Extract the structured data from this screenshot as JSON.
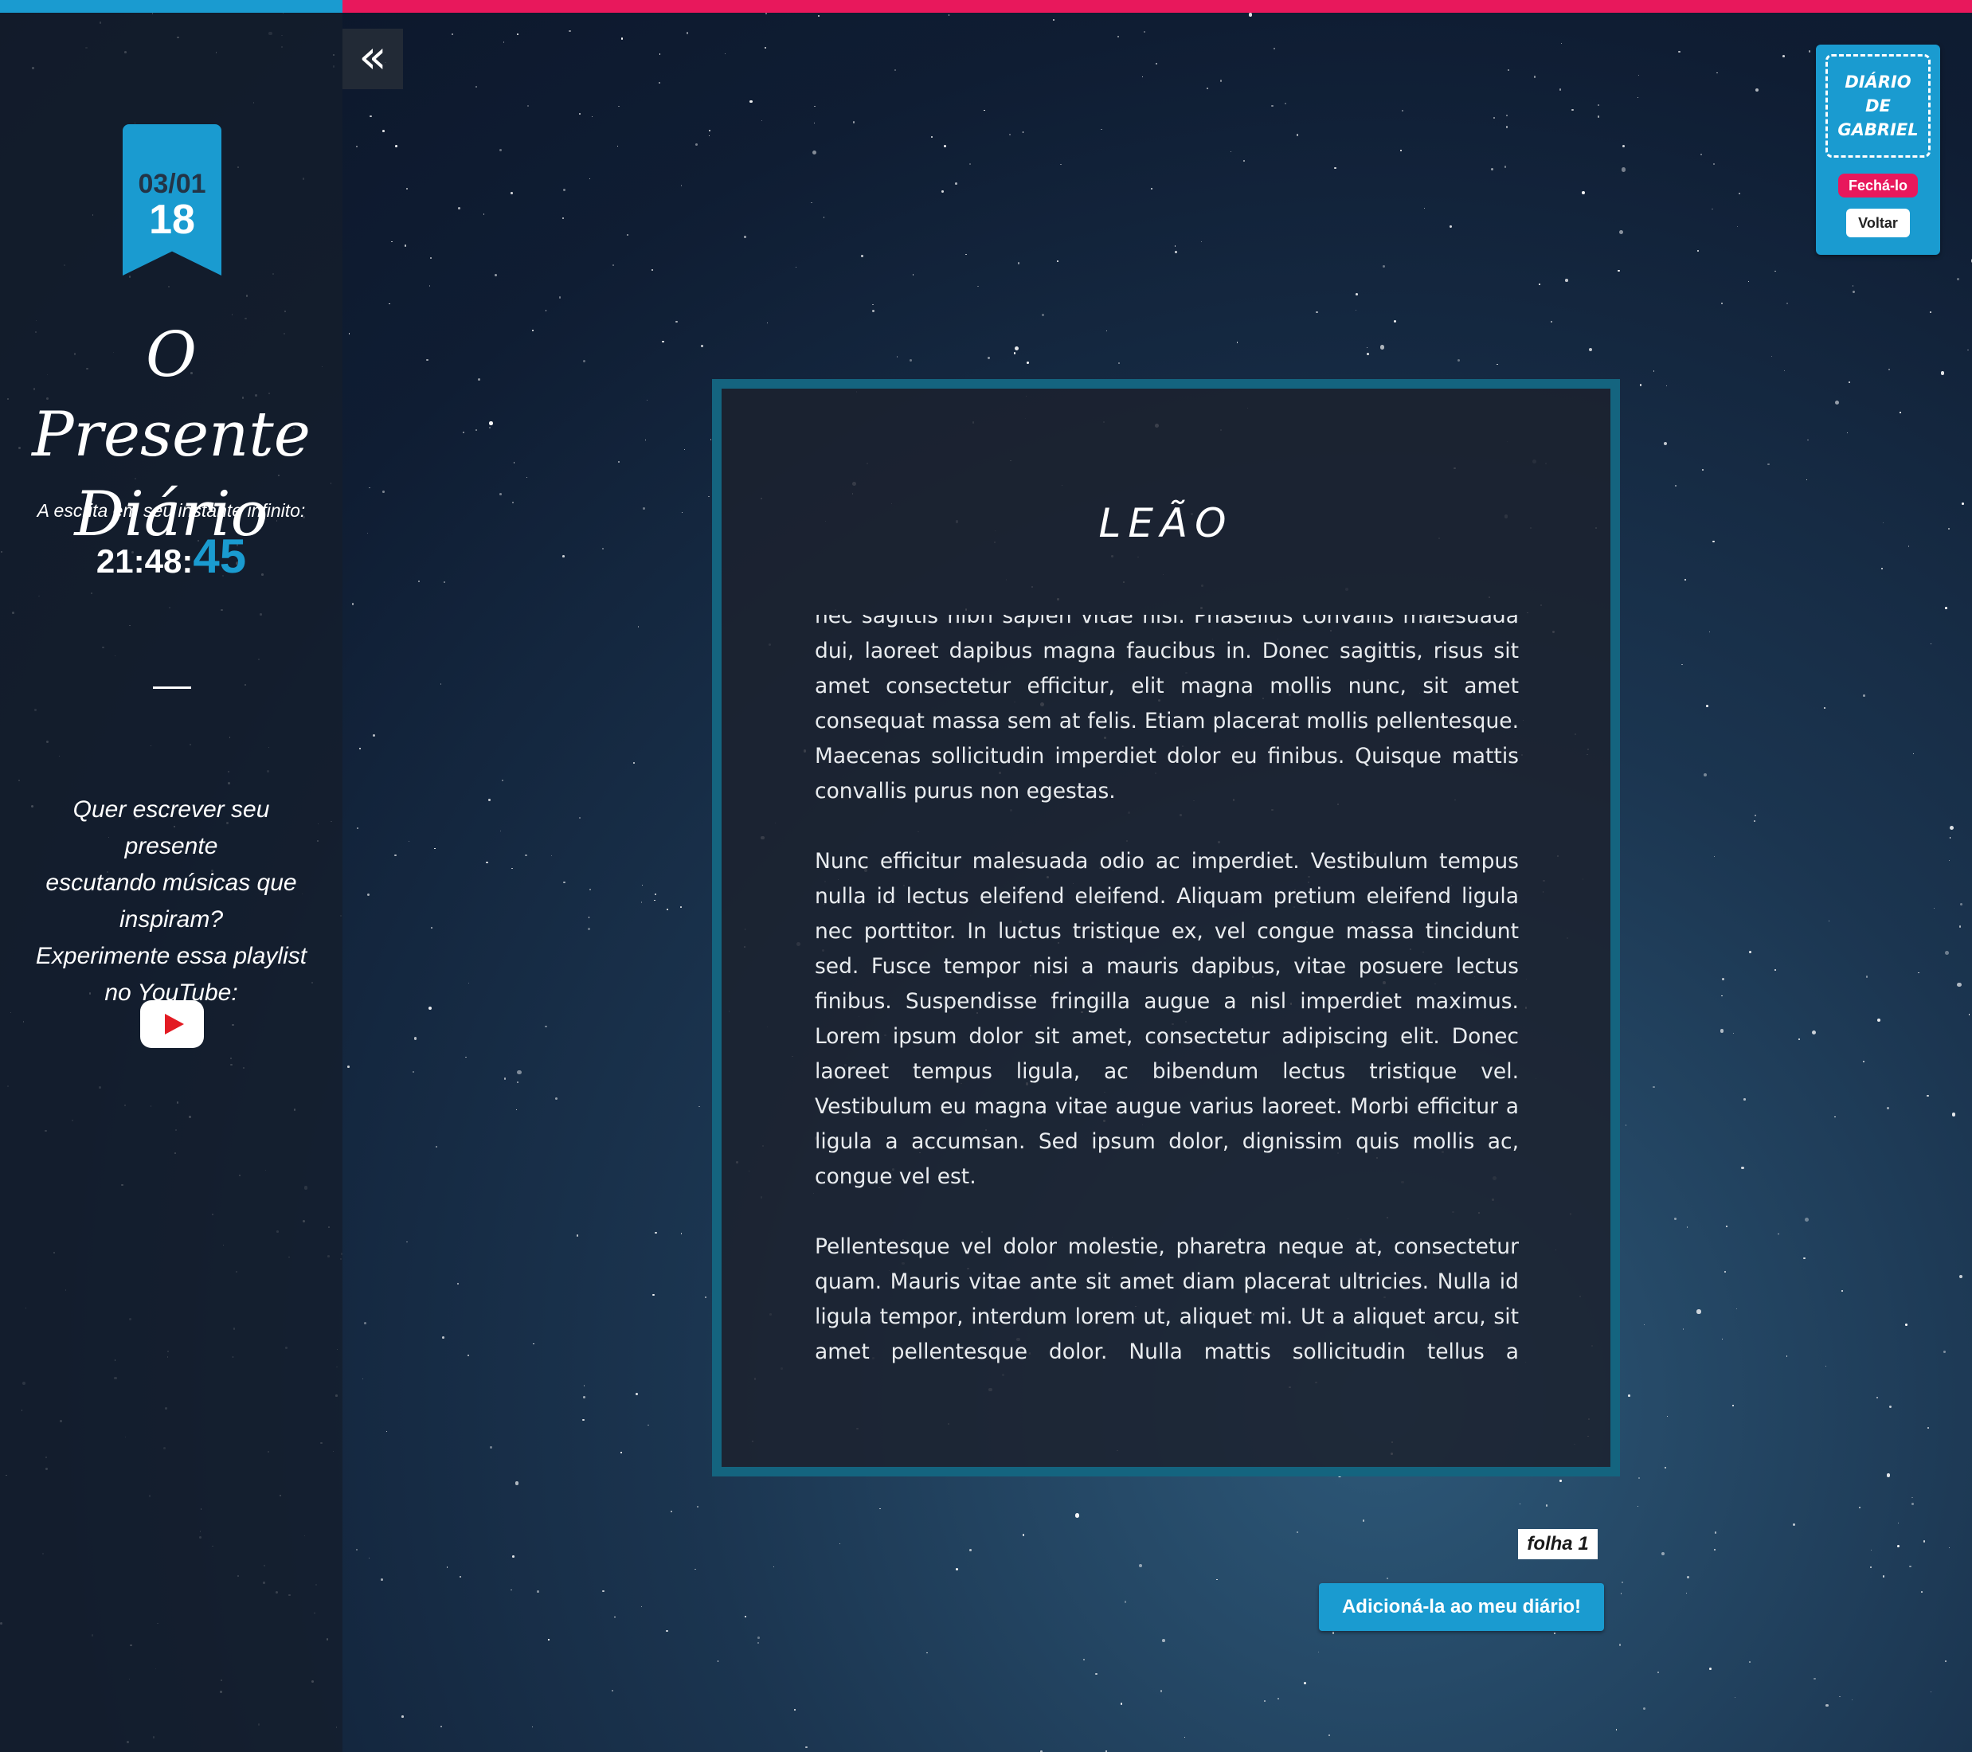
{
  "colors": {
    "accent": "#1a9bd0",
    "top_bar_left": "#1a9bd0",
    "top_bar_right": "#e8185c",
    "close_button": "#e8185c",
    "clock_seconds": "#1a9bd0",
    "panel_border": "#14647f"
  },
  "sidebar": {
    "collapse_icon": "double-chevron-left-icon",
    "collapse_glyph": "«",
    "date": {
      "day_month": "03/01",
      "year": "18"
    },
    "title_line1": "O Presente",
    "title_line2": "Diário",
    "tagline": "A escrita em seu instante infinito:",
    "clock": {
      "hours_minutes": "21:48:",
      "seconds": "45"
    },
    "playlist_lines": [
      "Quer escrever seu presente",
      "escutando músicas que",
      "inspiram?",
      "Experimente essa playlist",
      "no YouTube:"
    ],
    "youtube_icon": "youtube-play-icon"
  },
  "entry": {
    "title": "LEÃO",
    "paragraphs": [
      "nec sagittis nibh sapien vitae nisi. Phasellus convallis malesuada dui, laoreet dapibus magna faucibus in. Donec sagittis, risus sit amet consectetur efficitur, elit magna mollis nunc, sit amet consequat massa sem at felis. Etiam placerat mollis pellentesque. Maecenas sollicitudin imperdiet dolor eu finibus. Quisque mattis convallis purus non egestas.",
      "Nunc efficitur malesuada odio ac imperdiet. Vestibulum tempus nulla id lectus eleifend eleifend. Aliquam pretium eleifend ligula nec porttitor. In luctus tristique ex, vel congue massa tincidunt sed. Fusce tempor nisi a mauris dapibus, vitae posuere lectus finibus. Suspendisse fringilla augue a nisl imperdiet maximus. Lorem ipsum dolor sit amet, consectetur adipiscing elit. Donec laoreet tempus ligula, ac bibendum lectus tristique vel. Vestibulum eu magna vitae augue varius laoreet. Morbi efficitur a ligula a accumsan. Sed ipsum dolor, dignissim quis mollis ac, congue vel est.",
      "Pellentesque vel dolor molestie, pharetra neque at, consectetur quam. Mauris vitae ante sit amet diam placerat ultricies. Nulla id ligula tempor, interdum lorem ut, aliquet mi. Ut a aliquet arcu, sit amet pellentesque dolor. Nulla mattis sollicitudin tellus a tincidunt. Maecenas luctus id lorem in mollis. Quisque ut consectetur mauris, vitae sodales urna. Suspendisse at nibh eu lacus porta malesuada."
    ],
    "sheet_label": "folha 1",
    "add_button": "Adicioná-la ao meu diário!"
  },
  "diary_card": {
    "label_lines": [
      "DIÁRIO",
      "DE",
      "GABRIEL"
    ],
    "close_button": "Fechá-lo",
    "back_button": "Voltar"
  }
}
